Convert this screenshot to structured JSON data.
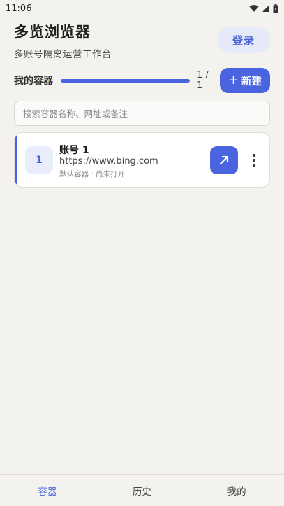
{
  "status_bar": {
    "time": "11:06"
  },
  "header": {
    "title": "多览浏览器",
    "subtitle": "多账号隔离运营工作台",
    "login_label": "登录"
  },
  "containers_section": {
    "title": "我的容器",
    "progress_fraction": 1.0,
    "count_text": "1 / 1",
    "new_button_icon": "+",
    "new_button_label": "新建"
  },
  "search": {
    "placeholder": "搜索容器名称、网址或备注",
    "value": ""
  },
  "container_list": [
    {
      "index": "1",
      "name": "账号 1",
      "url": "https://www.bing.com",
      "meta": "默认容器 · 尚未打开",
      "open_icon": "arrow-up-right-icon",
      "more_icon": "more-vertical-icon"
    }
  ],
  "bottom_nav": [
    {
      "label": "容器",
      "active": true
    },
    {
      "label": "历史",
      "active": false
    },
    {
      "label": "我的",
      "active": false
    }
  ],
  "colors": {
    "accent": "#4a64e0",
    "background": "#f4f2ee",
    "login_bg": "#e6e9f7"
  }
}
